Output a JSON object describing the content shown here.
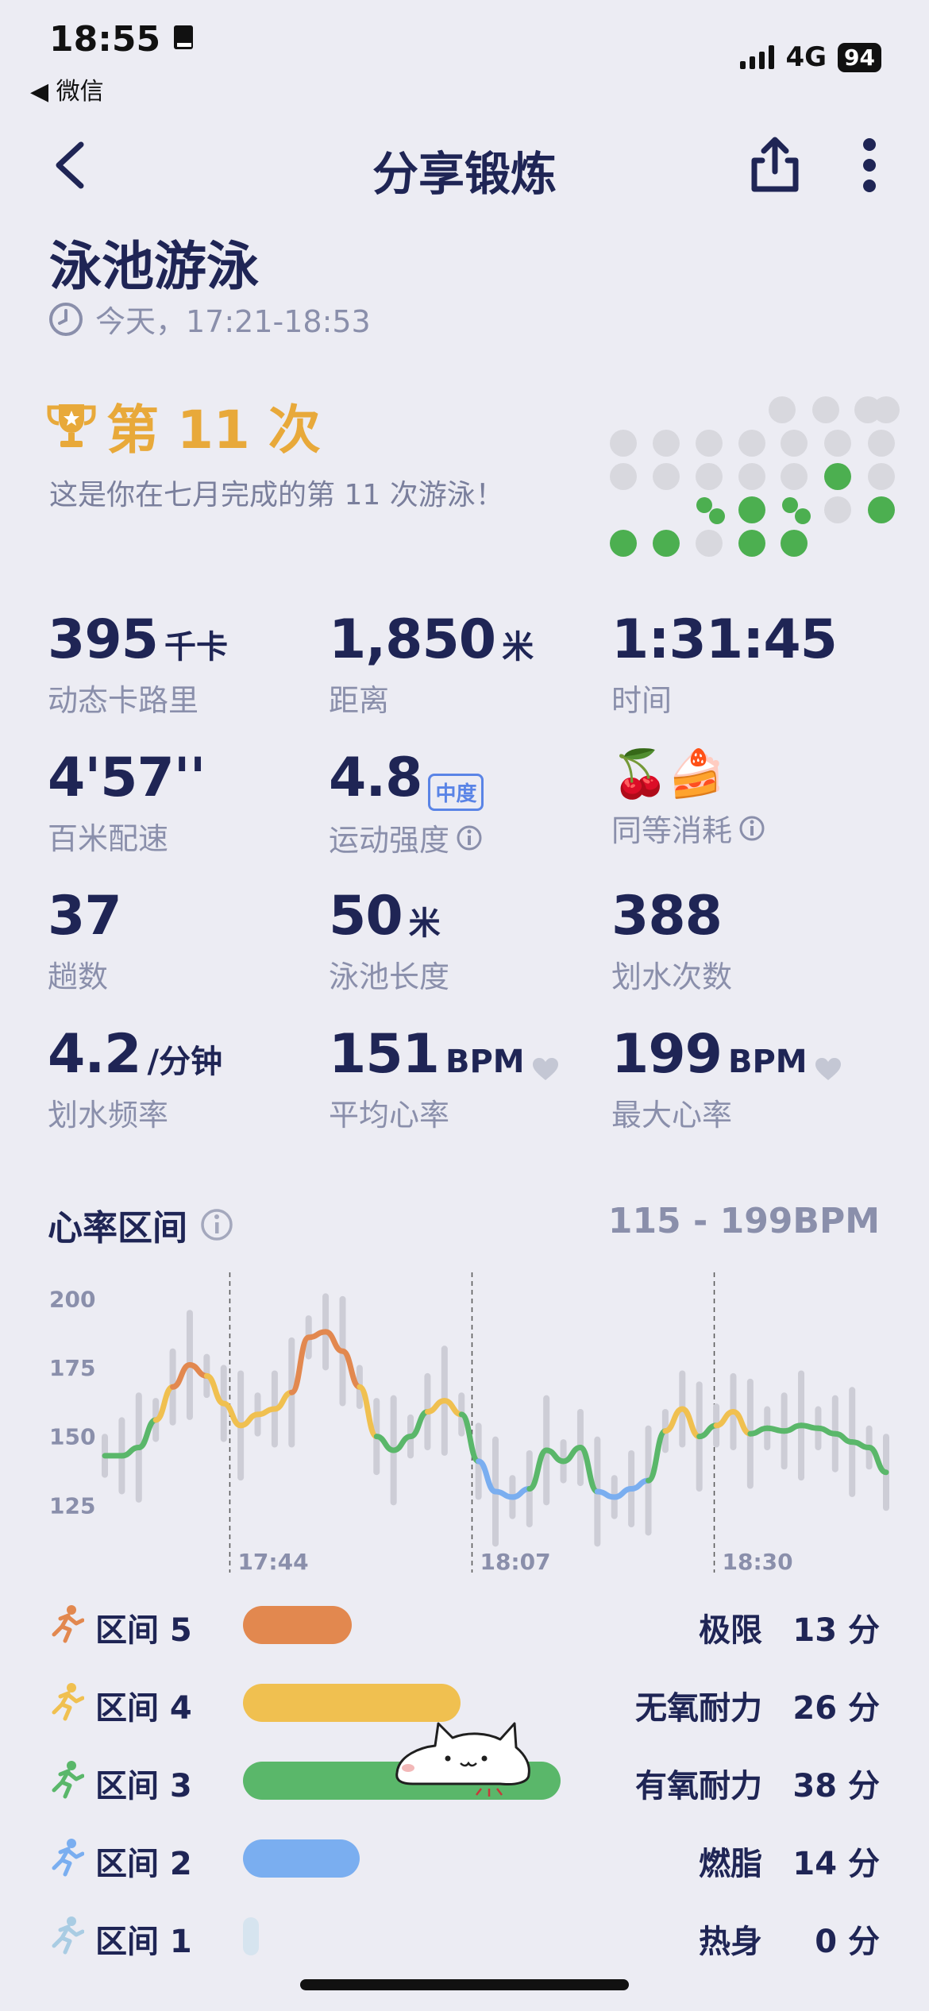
{
  "status": {
    "time": "18:55",
    "back_app": "◀ 微信",
    "network": "4G",
    "battery": "94"
  },
  "nav": {
    "title": "分享锻炼"
  },
  "workout": {
    "title": "泳池游泳",
    "time": "今天，17:21-18:53"
  },
  "achievement": {
    "count_text": "第 11 次",
    "subtitle": "这是你在七月完成的第 11 次游泳！"
  },
  "stats": {
    "calories": {
      "value": "395",
      "unit": "千卡",
      "label": "动态卡路里"
    },
    "distance": {
      "value": "1,850",
      "unit": "米",
      "label": "距离"
    },
    "duration": {
      "value": "1:31:45",
      "label": "时间"
    },
    "pace": {
      "value": "4'57''",
      "label": "百米配速"
    },
    "intensity": {
      "value": "4.8",
      "tag": "中度",
      "label": "运动强度"
    },
    "equivalent": {
      "icons": "🍒🍰",
      "label": "同等消耗"
    },
    "laps": {
      "value": "37",
      "label": "趟数"
    },
    "pool_length": {
      "value": "50",
      "unit": "米",
      "label": "泳池长度"
    },
    "strokes": {
      "value": "388",
      "label": "划水次数"
    },
    "stroke_rate": {
      "value": "4.2",
      "unit": "/分钟",
      "label": "划水频率"
    },
    "avg_hr": {
      "value": "151",
      "unit": "BPM",
      "label": "平均心率"
    },
    "max_hr": {
      "value": "199",
      "unit": "BPM",
      "label": "最大心率"
    }
  },
  "hr_section": {
    "title": "心率区间",
    "range": "115 - 199BPM"
  },
  "chart_data": {
    "type": "line",
    "title": "",
    "ylim": [
      115,
      205
    ],
    "y_ticks": [
      200,
      175,
      150,
      125
    ],
    "x_ticks": [
      "17:44",
      "18:07",
      "18:30"
    ],
    "x": [
      0,
      2,
      4,
      6,
      8,
      10,
      12,
      14,
      16,
      18,
      20,
      22,
      24,
      26,
      28,
      30,
      32,
      34,
      36,
      38,
      40,
      42,
      44,
      46,
      48,
      50,
      52,
      54,
      56,
      58,
      60,
      62,
      64,
      66,
      68,
      70,
      72,
      74,
      76,
      78,
      80,
      82,
      84,
      86,
      88,
      90,
      92
    ],
    "values": [
      143,
      143,
      146,
      156,
      168,
      176,
      172,
      162,
      154,
      158,
      160,
      166,
      186,
      188,
      181,
      168,
      150,
      145,
      150,
      159,
      163,
      158,
      141,
      130,
      128,
      131,
      145,
      141,
      146,
      130,
      128,
      131,
      134,
      152,
      160,
      150,
      154,
      159,
      151,
      153,
      152,
      154,
      153,
      151,
      148,
      146,
      137
    ],
    "zone_colors": {
      "z5": "#e2884f",
      "z4": "#f0c050",
      "z3": "#5ab76a",
      "z2": "#7aaef0"
    }
  },
  "zones": [
    {
      "name": "区间 5",
      "desc": "极限",
      "minutes": "13 分",
      "value": 13,
      "color": "#e2884f",
      "icon_color": "#e2884f"
    },
    {
      "name": "区间 4",
      "desc": "无氧耐力",
      "minutes": "26 分",
      "value": 26,
      "color": "#f0c050",
      "icon_color": "#f0c050"
    },
    {
      "name": "区间 3",
      "desc": "有氧耐力",
      "minutes": "38 分",
      "value": 38,
      "color": "#5ab76a",
      "icon_color": "#5ab76a"
    },
    {
      "name": "区间 2",
      "desc": "燃脂",
      "minutes": "14 分",
      "value": 14,
      "color": "#7aaef0",
      "icon_color": "#7aaef0"
    },
    {
      "name": "区间 1",
      "desc": "热身",
      "minutes": "0 分",
      "value": 0,
      "color": "#d6e4ef",
      "icon_color": "#a9cce3"
    }
  ],
  "colors": {
    "accent": "#e8a93a",
    "text": "#1f2555",
    "muted": "#8a8fab",
    "dot_green": "#4caf50",
    "dot_gray": "#d8d8de"
  }
}
